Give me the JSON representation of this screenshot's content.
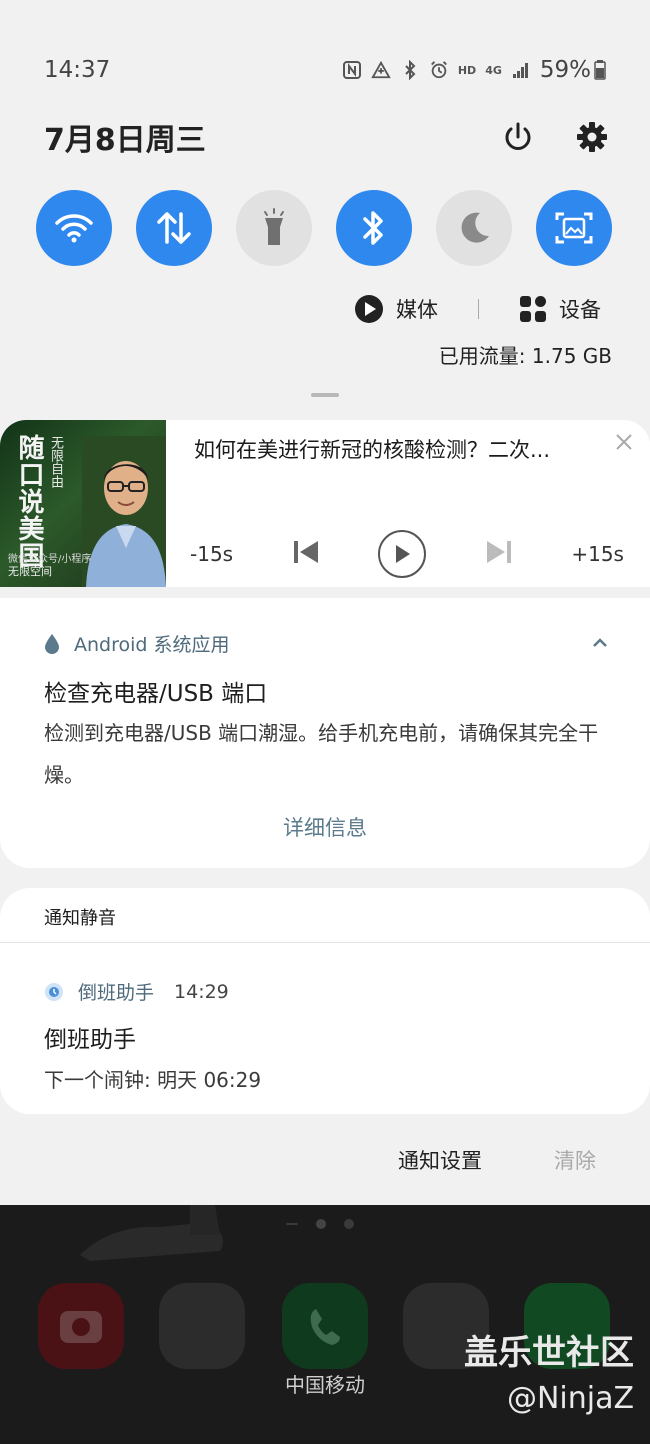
{
  "status_bar": {
    "time": "14:37",
    "icons": [
      "nfc-icon",
      "data-saver-icon",
      "bluetooth-icon",
      "alarm-icon",
      "hd-icon",
      "4g-signal-icon"
    ],
    "hd": "HD",
    "network": "4G",
    "battery": "59%"
  },
  "header": {
    "date": "7月8日周三",
    "power_icon": "power-icon",
    "settings_icon": "gear-icon"
  },
  "quick_tiles": [
    {
      "name": "wifi",
      "icon": "wifi-icon",
      "active": true
    },
    {
      "name": "mobile-data",
      "icon": "data-arrows-icon",
      "active": true
    },
    {
      "name": "flashlight",
      "icon": "flashlight-icon",
      "active": false
    },
    {
      "name": "bluetooth",
      "icon": "bluetooth-icon",
      "active": true
    },
    {
      "name": "dark-mode",
      "icon": "moon-icon",
      "active": false
    },
    {
      "name": "screen-capture",
      "icon": "screenshot-icon",
      "active": true
    }
  ],
  "media_device": {
    "media_label": "媒体",
    "device_label": "设备"
  },
  "data_usage": "已用流量: 1.75 GB",
  "media_notification": {
    "title": "如何在美进行新冠的核酸检测？二次...",
    "art_title": "随口说美国",
    "art_subtitle": "无限自由",
    "art_caption": "微信公众号/小程序",
    "art_caption2": "无限空间",
    "rewind": "-15s",
    "forward": "+15s"
  },
  "android_notification": {
    "app": "Android 系统应用",
    "title": "检查充电器/USB 端口",
    "body": "检测到充电器/USB 端口潮湿。给手机充电前，请确保其完全干燥。",
    "action": "详细信息"
  },
  "silent_section": {
    "header": "通知静音",
    "app": "倒班助手",
    "time": "14:29",
    "title": "倒班助手",
    "body": "下一个闹钟: 明天 06:29"
  },
  "actions": {
    "settings": "通知设置",
    "clear": "清除"
  },
  "home": {
    "label": "中国移动"
  },
  "watermark": {
    "line1": "盖乐世社区",
    "line2": "@NinjaZ"
  },
  "colors": {
    "accent": "#2f88ee",
    "tile_off": "#e1e1e1",
    "app_label": "#4e6a7c",
    "panel_bg": "#f1f1f1"
  }
}
